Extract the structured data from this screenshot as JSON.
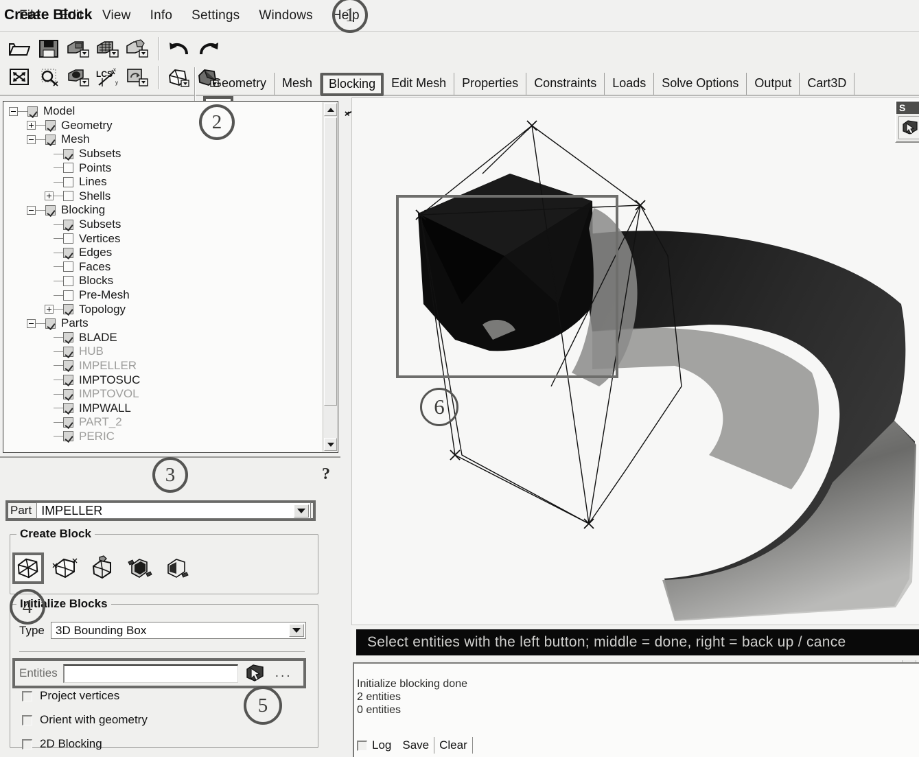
{
  "menu": {
    "items": [
      {
        "label": "File"
      },
      {
        "label": "Edit"
      },
      {
        "label": "View"
      },
      {
        "label": "Info"
      },
      {
        "label": "Settings"
      },
      {
        "label": "Windows"
      },
      {
        "label": "Help"
      }
    ]
  },
  "toolbar": {
    "row1": [
      {
        "name": "open-file-icon"
      },
      {
        "name": "save-icon"
      },
      {
        "name": "save-geometry-icon"
      },
      {
        "name": "save-mesh-icon"
      },
      {
        "name": "save-blocking-icon"
      }
    ],
    "row2": [
      {
        "name": "fit-window-icon"
      },
      {
        "name": "zoom-box-icon"
      },
      {
        "name": "measure-icon"
      },
      {
        "name": "lcs-icon"
      },
      {
        "name": "refresh-view-icon"
      }
    ],
    "undo_redo": [
      {
        "name": "undo-icon"
      },
      {
        "name": "redo-icon"
      }
    ],
    "display": [
      {
        "name": "wireframe-display-icon"
      },
      {
        "name": "solid-display-icon"
      }
    ]
  },
  "tabs": {
    "items": [
      {
        "label": "Geometry",
        "active": false
      },
      {
        "label": "Mesh",
        "active": false
      },
      {
        "label": "Blocking",
        "active": true
      },
      {
        "label": "Edit Mesh",
        "active": false
      },
      {
        "label": "Properties",
        "active": false
      },
      {
        "label": "Constraints",
        "active": false
      },
      {
        "label": "Loads",
        "active": false
      },
      {
        "label": "Solve Options",
        "active": false
      },
      {
        "label": "Output",
        "active": false
      },
      {
        "label": "Cart3D",
        "active": false
      }
    ]
  },
  "blocking_toolbar": {
    "items": [
      {
        "name": "create-block-icon",
        "selected": true
      },
      {
        "name": "split-block-icon",
        "selected": false
      },
      {
        "name": "merge-vertices-icon",
        "selected": false
      },
      {
        "name": "edit-block-icon",
        "selected": false
      },
      {
        "name": "associate-icon",
        "selected": false
      },
      {
        "name": "move-vertex-icon",
        "selected": false
      },
      {
        "name": "transform-blocks-icon",
        "selected": false
      },
      {
        "name": "edit-edge-icon",
        "selected": false
      },
      {
        "name": "pre-mesh-params-icon",
        "selected": false
      },
      {
        "name": "pre-mesh-quality-icon",
        "selected": false
      },
      {
        "name": "scan-planes-icon",
        "selected": false
      },
      {
        "name": "check-blocks-icon",
        "selected": false
      },
      {
        "name": "delete-block-icon",
        "selected": false
      }
    ]
  },
  "tree": {
    "nodes": [
      {
        "label": "Model",
        "indent": 0,
        "expander": "minus",
        "checkbox": "on",
        "dim": false
      },
      {
        "label": "Geometry",
        "indent": 1,
        "expander": "plus",
        "checkbox": "on",
        "dim": false
      },
      {
        "label": "Mesh",
        "indent": 1,
        "expander": "minus",
        "checkbox": "on",
        "dim": false
      },
      {
        "label": "Subsets",
        "indent": 2,
        "expander": "none",
        "checkbox": "on",
        "dim": false
      },
      {
        "label": "Points",
        "indent": 2,
        "expander": "none",
        "checkbox": "off",
        "dim": false
      },
      {
        "label": "Lines",
        "indent": 2,
        "expander": "none",
        "checkbox": "off",
        "dim": false
      },
      {
        "label": "Shells",
        "indent": 2,
        "expander": "plus",
        "checkbox": "off",
        "dim": false
      },
      {
        "label": "Blocking",
        "indent": 1,
        "expander": "minus",
        "checkbox": "on",
        "dim": false
      },
      {
        "label": "Subsets",
        "indent": 2,
        "expander": "none",
        "checkbox": "on",
        "dim": false
      },
      {
        "label": "Vertices",
        "indent": 2,
        "expander": "none",
        "checkbox": "off",
        "dim": false
      },
      {
        "label": "Edges",
        "indent": 2,
        "expander": "none",
        "checkbox": "on",
        "dim": false
      },
      {
        "label": "Faces",
        "indent": 2,
        "expander": "none",
        "checkbox": "off",
        "dim": false
      },
      {
        "label": "Blocks",
        "indent": 2,
        "expander": "none",
        "checkbox": "off",
        "dim": false
      },
      {
        "label": "Pre-Mesh",
        "indent": 2,
        "expander": "none",
        "checkbox": "off",
        "dim": false
      },
      {
        "label": "Topology",
        "indent": 2,
        "expander": "plus",
        "checkbox": "on",
        "dim": false
      },
      {
        "label": "Parts",
        "indent": 1,
        "expander": "minus",
        "checkbox": "on",
        "dim": false
      },
      {
        "label": "BLADE",
        "indent": 2,
        "expander": "none",
        "checkbox": "on",
        "dim": false
      },
      {
        "label": "HUB",
        "indent": 2,
        "expander": "none",
        "checkbox": "on",
        "dim": true
      },
      {
        "label": "IMPELLER",
        "indent": 2,
        "expander": "none",
        "checkbox": "on",
        "dim": true
      },
      {
        "label": "IMPTOSUC",
        "indent": 2,
        "expander": "none",
        "checkbox": "on",
        "dim": false
      },
      {
        "label": "IMPTOVOL",
        "indent": 2,
        "expander": "none",
        "checkbox": "on",
        "dim": true
      },
      {
        "label": "IMPWALL",
        "indent": 2,
        "expander": "none",
        "checkbox": "on",
        "dim": false
      },
      {
        "label": "PART_2",
        "indent": 2,
        "expander": "none",
        "checkbox": "on",
        "dim": true
      },
      {
        "label": "PERIC",
        "indent": 2,
        "expander": "none",
        "checkbox": "on",
        "dim": true
      }
    ]
  },
  "create_block": {
    "title": "Create Block",
    "help_glyph": "?",
    "part_label": "Part",
    "part_value": "IMPELLER",
    "group_label": "Create Block",
    "method_icons": [
      {
        "name": "from-bounding-box-icon",
        "selected": true
      },
      {
        "name": "from-vertices-icon",
        "selected": false
      },
      {
        "name": "from-faces-icon",
        "selected": false
      },
      {
        "name": "2d-to-3d-icon",
        "selected": false
      },
      {
        "name": "extrude-face-icon",
        "selected": false
      }
    ],
    "initialize_label": "Initialize Blocks",
    "type_label": "Type",
    "type_value": "3D Bounding Box",
    "entities_label": "Entities",
    "entities_value": "",
    "entities_pick_icon": "select-entities-cursor-icon",
    "entities_more": "...",
    "checkboxes": [
      {
        "label": "Project vertices",
        "checked": false
      },
      {
        "label": "Orient with geometry",
        "checked": false
      },
      {
        "label": "2D Blocking",
        "checked": false
      }
    ]
  },
  "viewport": {
    "selection_box": true,
    "status_message": "Select entities with the left button; middle = done, right = back up / cance"
  },
  "mini_toolbar": {
    "title": "S",
    "icon": "select-tool-icon"
  },
  "log": {
    "lines": [
      "Initialize blocking done",
      "2 entities",
      "0 entities"
    ],
    "log_checkbox_label": "Log",
    "save_label": "Save",
    "clear_label": "Clear"
  },
  "callouts": [
    {
      "id": "1",
      "label": "1"
    },
    {
      "id": "2",
      "label": "2"
    },
    {
      "id": "3",
      "label": "3"
    },
    {
      "id": "4",
      "label": "4"
    },
    {
      "id": "5",
      "label": "5"
    },
    {
      "id": "6",
      "label": "6"
    }
  ],
  "colors": {
    "background": "#f0f0ee",
    "panel": "#fbfbfa",
    "highlight_border": "#5d5d5b",
    "status_bg": "#090909",
    "status_fg": "#cfcfcd"
  }
}
